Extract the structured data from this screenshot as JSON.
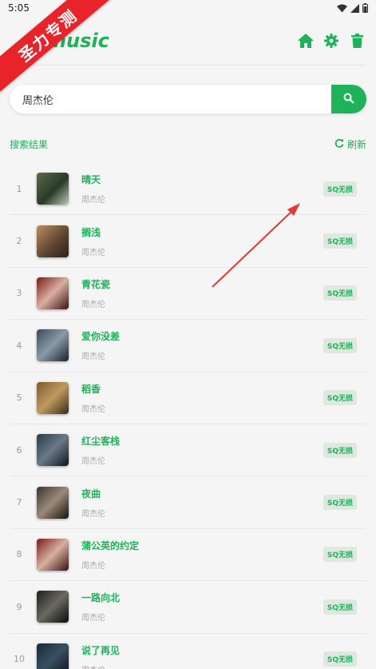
{
  "status": {
    "time": "5:05"
  },
  "banner": {
    "text": "圣力专测"
  },
  "app": {
    "logo": "music"
  },
  "search": {
    "value": "周杰伦",
    "placeholder": ""
  },
  "results": {
    "label": "搜索结果",
    "refresh_label": "刷新"
  },
  "songs": [
    {
      "index": "1",
      "title": "晴天",
      "artist": "周杰伦",
      "quality": "SQ无损"
    },
    {
      "index": "2",
      "title": "搁浅",
      "artist": "周杰伦",
      "quality": "SQ无损"
    },
    {
      "index": "3",
      "title": "青花瓷",
      "artist": "周杰伦",
      "quality": "SQ无损"
    },
    {
      "index": "4",
      "title": "爱你没差",
      "artist": "周杰伦",
      "quality": "SQ无损"
    },
    {
      "index": "5",
      "title": "稻香",
      "artist": "周杰伦",
      "quality": "SQ无损"
    },
    {
      "index": "6",
      "title": "红尘客栈",
      "artist": "周杰伦",
      "quality": "SQ无损"
    },
    {
      "index": "7",
      "title": "夜曲",
      "artist": "周杰伦",
      "quality": "SQ无损"
    },
    {
      "index": "8",
      "title": "蒲公英的约定",
      "artist": "周杰伦",
      "quality": "SQ无损"
    },
    {
      "index": "9",
      "title": "一路向北",
      "artist": "周杰伦",
      "quality": "SQ无损"
    },
    {
      "index": "10",
      "title": "说了再见",
      "artist": "周杰伦",
      "quality": "SQ无损"
    }
  ],
  "colors": {
    "accent": "#1eb35a",
    "banner": "#e8232a",
    "arrow": "#e53935"
  },
  "icons": [
    "wifi-icon",
    "signal-icon",
    "battery-icon",
    "home-icon",
    "settings-icon",
    "trash-icon",
    "search-icon",
    "refresh-icon"
  ]
}
